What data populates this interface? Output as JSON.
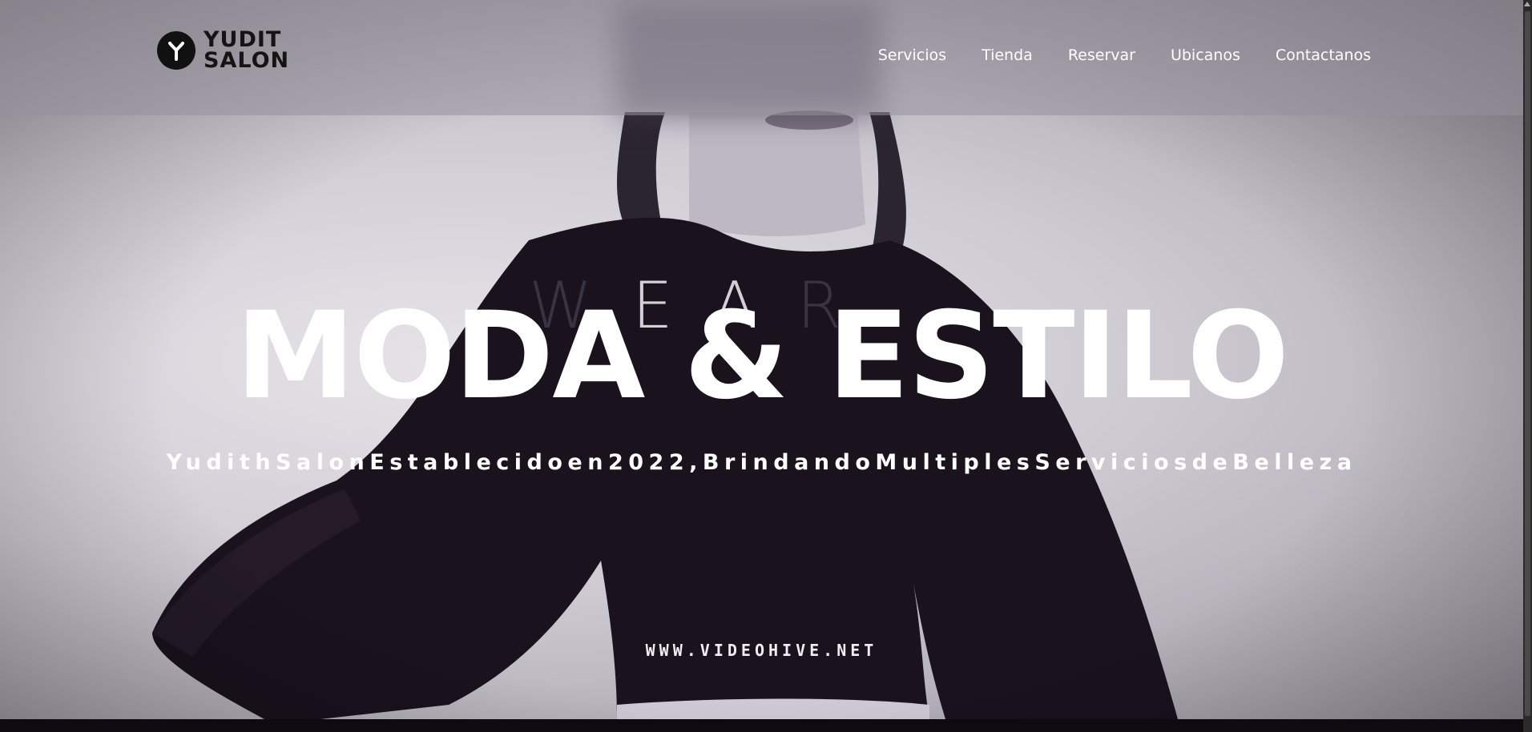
{
  "brand": {
    "name_line1": "YUDIT",
    "name_line2": "SALON"
  },
  "nav": {
    "items": [
      {
        "label": "Servicios"
      },
      {
        "label": "Tienda"
      },
      {
        "label": "Reservar"
      },
      {
        "label": "Ubicanos"
      },
      {
        "label": "Contactanos"
      }
    ]
  },
  "hero": {
    "background_text": [
      "W",
      "E",
      "A",
      "R"
    ],
    "title": "MODA & ESTILO",
    "subtitle": "YudithSalonEstablecidoen2022,BrindandoMultiplesServiciosdeBelleza",
    "watermark": "WWW.VIDEOHIVE.NET"
  },
  "colors": {
    "text_primary": "#ffffff",
    "logo_dark": "#111111",
    "header_overlay": "#96929c"
  },
  "icons": {
    "logo": "y-monogram-icon"
  }
}
